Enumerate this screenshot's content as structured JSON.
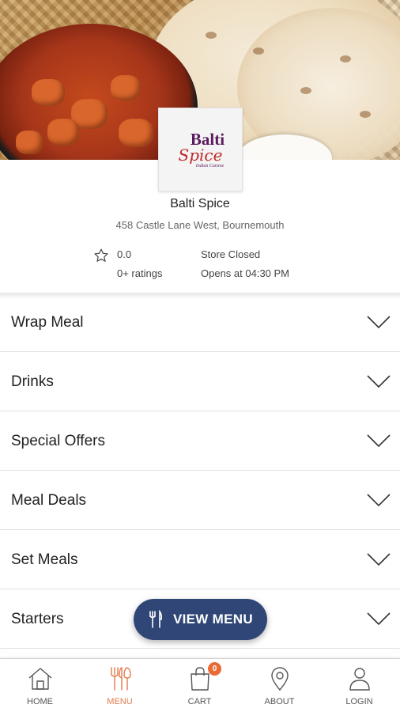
{
  "store": {
    "name": "Balti Spice",
    "address": "458 Castle Lane West, Bournemouth",
    "rating_value": "0.0",
    "rating_count": "0+ ratings",
    "status": "Store Closed",
    "opening": "Opens at 04:30 PM"
  },
  "logo": {
    "title": "Balti",
    "script": "Spice",
    "subtitle": "Indian Cuisine"
  },
  "categories": [
    {
      "label": "Wrap Meal"
    },
    {
      "label": "Drinks"
    },
    {
      "label": "Special Offers"
    },
    {
      "label": "Meal Deals"
    },
    {
      "label": "Set Meals"
    },
    {
      "label": "Starters"
    }
  ],
  "fab": {
    "label": "VIEW MENU",
    "icon": "cutlery-icon"
  },
  "nav": {
    "items": [
      {
        "label": "HOME",
        "icon": "home-icon"
      },
      {
        "label": "MENU",
        "icon": "cutlery-icon",
        "active": true
      },
      {
        "label": "CART",
        "icon": "shopping-bag-icon",
        "badge": "0"
      },
      {
        "label": "ABOUT",
        "icon": "location-pin-icon"
      },
      {
        "label": "LOGIN",
        "icon": "user-icon"
      }
    ]
  },
  "colors": {
    "primary": "#2f4677",
    "accent": "#e07b4c",
    "badge": "#ea6a35",
    "logo_purple": "#5a1c5e",
    "logo_red": "#c0282a"
  }
}
